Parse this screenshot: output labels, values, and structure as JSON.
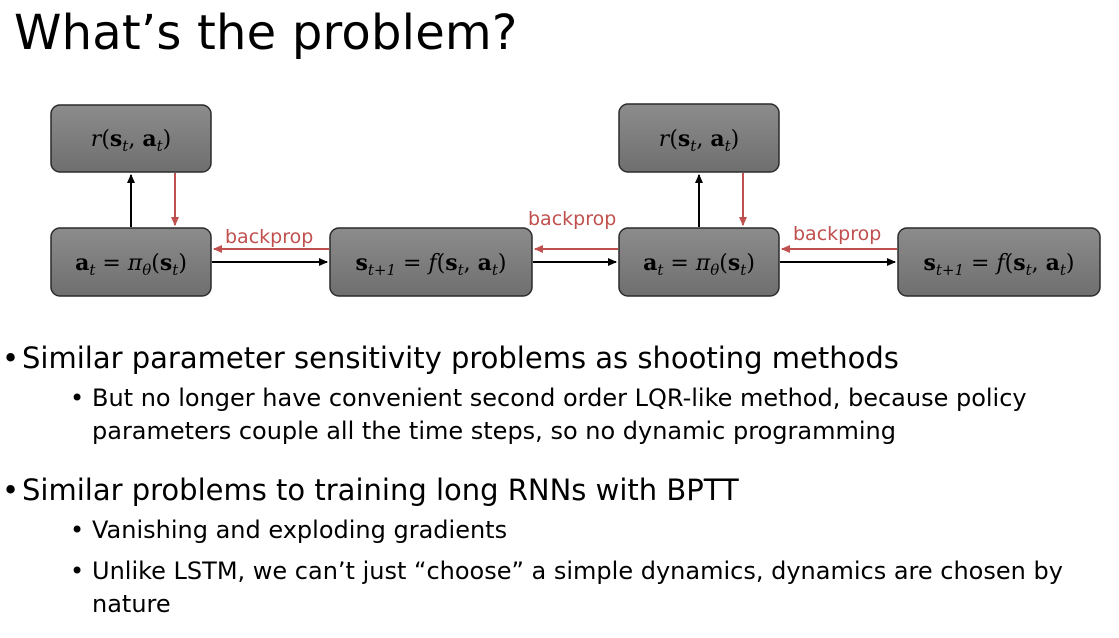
{
  "title": "What’s the problem?",
  "diagram": {
    "nodes": [
      {
        "id": "reward-1",
        "label": "r(s_t, a_t)"
      },
      {
        "id": "policy-1",
        "label": "a_t = π_θ(s_t)"
      },
      {
        "id": "dynamics-1",
        "label": "s_t+1 = f(s_t, a_t)"
      },
      {
        "id": "reward-2",
        "label": "r(s_t, a_t)"
      },
      {
        "id": "policy-2",
        "label": "a_t = π_θ(s_t)"
      },
      {
        "id": "dynamics-2",
        "label": "s_t+1 = f(s_t, a_t)"
      }
    ],
    "backprop_labels": [
      "backprop",
      "backprop",
      "backprop"
    ],
    "colors": {
      "node_fill": "#7f7f7f",
      "node_stroke": "#2b2b2b",
      "forward_arrow": "#000000",
      "backprop_arrow": "#c0504d"
    }
  },
  "bullets": [
    {
      "text": "Similar parameter sensitivity problems as shooting methods",
      "sub": [
        "But no longer have convenient second order LQR-like method, because policy parameters couple all the time steps, so no dynamic programming"
      ]
    },
    {
      "text": "Similar problems to training long RNNs with BPTT",
      "sub": [
        "Vanishing and exploding gradients",
        "Unlike LSTM, we can’t just “choose” a simple dynamics, dynamics are chosen by nature"
      ]
    }
  ]
}
